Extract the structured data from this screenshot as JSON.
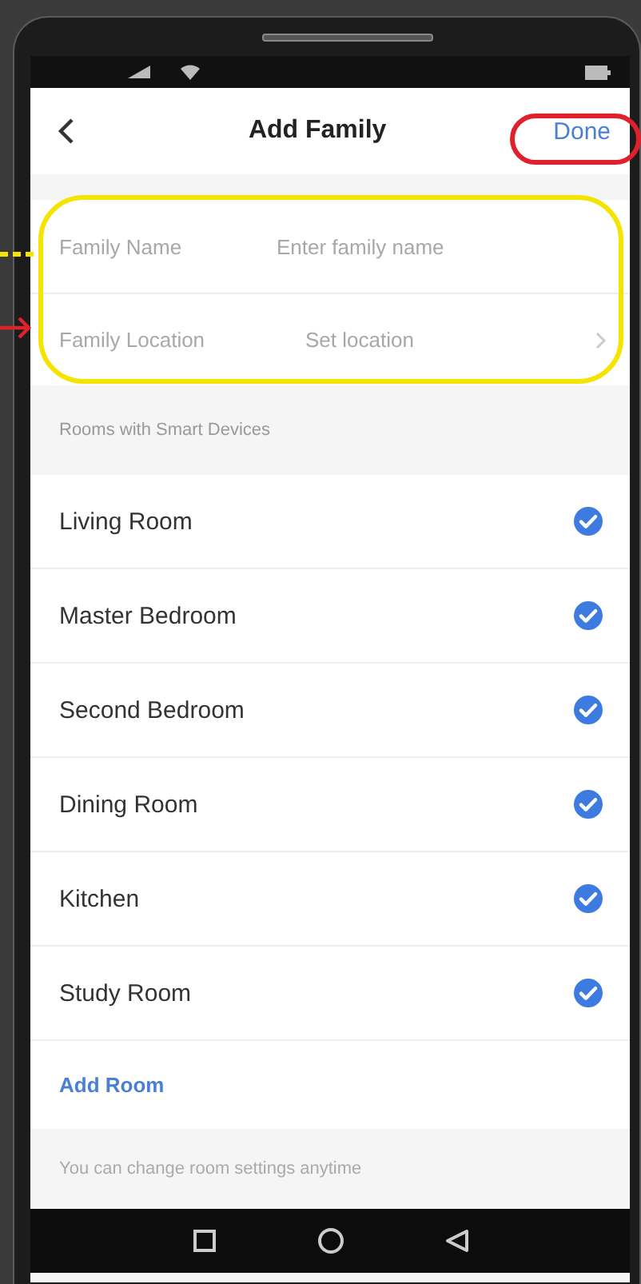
{
  "header": {
    "title": "Add Family",
    "action": "Done"
  },
  "form": [
    {
      "kind": "input",
      "label": "Family Name",
      "placeholder": "Enter family name"
    },
    {
      "kind": "picker",
      "label": "Family Location",
      "value": "Set location"
    }
  ],
  "rooms_header": "Rooms with Smart Devices",
  "rooms": [
    {
      "name": "Living Room",
      "checked": true
    },
    {
      "name": "Master Bedroom",
      "checked": true
    },
    {
      "name": "Second Bedroom",
      "checked": true
    },
    {
      "name": "Dining Room",
      "checked": true
    },
    {
      "name": "Kitchen",
      "checked": true
    },
    {
      "name": "Study Room",
      "checked": true
    }
  ],
  "add_room": "Add Room",
  "footer_note": "You can change room settings anytime"
}
